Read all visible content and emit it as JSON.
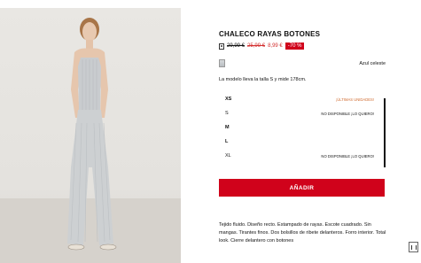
{
  "product": {
    "title": "CHALECO RAYAS BOTONES",
    "price_old_1": "29,99 €",
    "price_old_2": "25,99 €",
    "price_now": "8,99 €",
    "discount": "-70 %"
  },
  "color": {
    "name": "Azul celeste",
    "swatch": "#c9cdd0"
  },
  "model_info": "La modelo lleva la talla S y mide 178cm.",
  "sizes": [
    {
      "label": "XS",
      "status": "¡ÚLTIMAS UNIDADES!"
    },
    {
      "label": "S",
      "status": "NO DISPONIBLE ¡LO QUIERO!"
    },
    {
      "label": "M",
      "status": ""
    },
    {
      "label": "L",
      "status": ""
    },
    {
      "label": "XL",
      "status": "NO DISPONIBLE ¡LO QUIERO!"
    }
  ],
  "add_button": "AÑADIR",
  "description": "Tejido fluido. Diseño recto. Estampado de rayas. Escote cuadrado. Sin mangas. Tirantes finos. Dos bolsillos de ribete delanteros. Forro interior. Total look. Cierre delantero con botones",
  "colors": {
    "accent": "#d0021b",
    "sale": "#d32f2f",
    "last_units": "#d06a2e"
  }
}
